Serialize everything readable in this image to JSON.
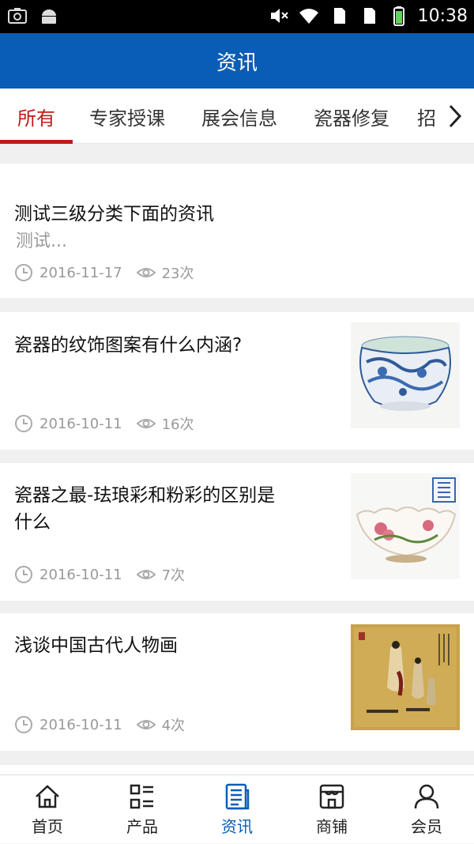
{
  "status_bar": {
    "time": "10:38",
    "icons": [
      "screenshot-icon",
      "android-icon",
      "mute-icon",
      "wifi-icon",
      "sim1-icon",
      "sim2-icon",
      "battery-icon"
    ]
  },
  "header": {
    "title": "资讯"
  },
  "tabs": [
    {
      "label": "所有",
      "active": true
    },
    {
      "label": "专家授课",
      "active": false
    },
    {
      "label": "展会信息",
      "active": false
    },
    {
      "label": "瓷器修复",
      "active": false
    },
    {
      "label": "招",
      "active": false
    }
  ],
  "articles": [
    {
      "title": "测试三级分类下面的资讯",
      "excerpt": "测试...",
      "date": "2016-11-17",
      "views": "23次",
      "has_image": false
    },
    {
      "title": "瓷器的纹饰图案有什么内涵?",
      "date": "2016-10-11",
      "views": "16次",
      "has_image": true,
      "image": "blue-white-porcelain-jar"
    },
    {
      "title_lines": [
        "瓷器之最-珐琅彩和粉彩的区别是",
        "什么"
      ],
      "date": "2016-10-11",
      "views": "7次",
      "has_image": true,
      "image": "famille-rose-peach-bowl"
    },
    {
      "title": "浅谈中国古代人物画",
      "date": "2016-10-11",
      "views": "4次",
      "has_image": true,
      "image": "ancient-figure-painting"
    }
  ],
  "bottom_nav": [
    {
      "label": "首页",
      "icon": "home-icon",
      "active": false
    },
    {
      "label": "产品",
      "icon": "list-grid-icon",
      "active": false
    },
    {
      "label": "资讯",
      "icon": "news-icon",
      "active": true
    },
    {
      "label": "商铺",
      "icon": "shop-icon",
      "active": false
    },
    {
      "label": "会员",
      "icon": "user-icon",
      "active": false
    }
  ],
  "colors": {
    "primary": "#0a5db5",
    "tab_active": "#c11a1a",
    "muted": "#999999"
  }
}
